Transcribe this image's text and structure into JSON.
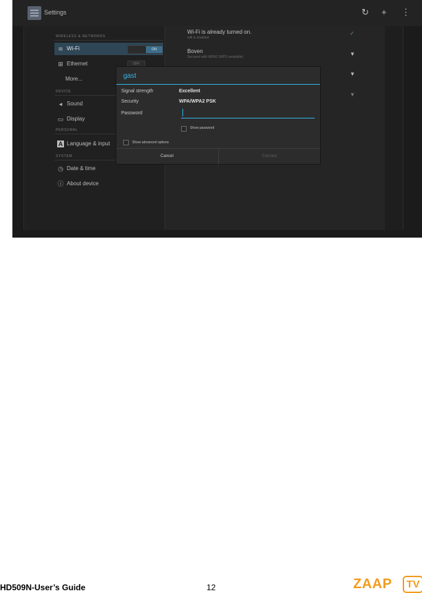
{
  "app": {
    "title": "Settings"
  },
  "toolbar": {
    "icons": [
      "refresh-wifi-icon",
      "plus-icon",
      "overflow-menu-icon"
    ],
    "icon_glyphs": [
      "↻",
      "+",
      "⋮"
    ]
  },
  "sidebar": {
    "sections": [
      "WIRELESS & NETWORKS",
      "DEVICE",
      "PERSONAL",
      "SYSTEM"
    ],
    "items": [
      {
        "label": "Wi-Fi",
        "toggle": "ON",
        "icon": "wifi-icon",
        "glyph": "≋"
      },
      {
        "label": "Ethernet",
        "toggle": "OFF",
        "icon": "ethernet-icon",
        "glyph": "⊞"
      },
      {
        "label": "More...",
        "icon": "",
        "glyph": ""
      },
      {
        "label": "Sound",
        "icon": "speaker-icon",
        "glyph": "◂"
      },
      {
        "label": "Display",
        "icon": "display-icon",
        "glyph": "▭"
      },
      {
        "label": "Language & input",
        "icon": "language-icon",
        "glyph": "A"
      },
      {
        "label": "Date & time",
        "icon": "clock-icon",
        "glyph": "◷"
      },
      {
        "label": "About device",
        "icon": "info-icon",
        "glyph": "ⓘ"
      }
    ]
  },
  "wifi_list": [
    {
      "title": "Wi-Fi is already turned on.",
      "subtitle": "wifi is enabled"
    },
    {
      "title": "Boven",
      "subtitle": "Secured with WPA2 (WPS available)"
    }
  ],
  "dialog": {
    "title": "gast",
    "fields": [
      {
        "key": "Signal strength",
        "value": "Excellent"
      },
      {
        "key": "Security",
        "value": "WPA/WPA2 PSK"
      },
      {
        "key": "Password",
        "value": ""
      }
    ],
    "show_password": "Show password",
    "show_advanced": "Show advanced options",
    "cancel": "Cancel",
    "connect": "Connect"
  },
  "footer": {
    "title": "HD509N-User’s Guide",
    "page": "12",
    "brand": "ZAAP",
    "brand_tv": "TV"
  },
  "colors": {
    "accent": "#33b5e5",
    "brand": "#f39c1f",
    "background": "#1b1b1b"
  }
}
